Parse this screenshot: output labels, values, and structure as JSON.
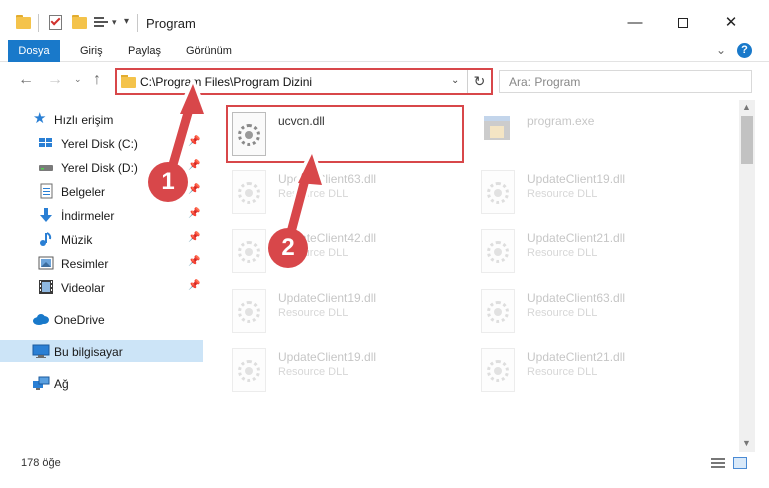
{
  "window": {
    "title": "Program",
    "minimize": "—",
    "maximize": "",
    "close": "✕"
  },
  "quick_access": {
    "dropdown_arrow": "▾",
    "customize_arrow": "▾"
  },
  "ribbon": {
    "tabs": [
      {
        "label": "Dosya"
      },
      {
        "label": "Giriş"
      },
      {
        "label": "Paylaş"
      },
      {
        "label": "Görünüm"
      }
    ],
    "collapse": "⌄",
    "help": "?"
  },
  "navigation": {
    "back": "←",
    "forward": "→",
    "recent": "⌄",
    "up": "↑"
  },
  "address": {
    "path": "C:\\Program Files\\Program Dizini",
    "dropdown": "⌄",
    "refresh": "↻"
  },
  "search": {
    "placeholder": "Ara: Program"
  },
  "sidebar": {
    "items": [
      {
        "label": "Hızlı erişim",
        "icon": "star-icon",
        "pinned": false
      },
      {
        "label": "Yerel Disk (C:)",
        "icon": "drive-icon",
        "pinned": true
      },
      {
        "label": "Yerel Disk (D:)",
        "icon": "drive-icon",
        "pinned": true
      },
      {
        "label": "Belgeler",
        "icon": "documents-icon",
        "pinned": true
      },
      {
        "label": "İndirmeler",
        "icon": "downloads-icon",
        "pinned": true
      },
      {
        "label": "Müzik",
        "icon": "music-icon",
        "pinned": true
      },
      {
        "label": "Resimler",
        "icon": "pictures-icon",
        "pinned": true
      },
      {
        "label": "Videolar",
        "icon": "videos-icon",
        "pinned": true
      },
      {
        "label": "OneDrive",
        "icon": "cloud-icon",
        "pinned": false
      },
      {
        "label": "Bu bilgisayar",
        "icon": "computer-icon",
        "pinned": false,
        "selected": true
      },
      {
        "label": "Ağ",
        "icon": "network-icon",
        "pinned": false
      }
    ],
    "pin_glyph": "📌"
  },
  "files": [
    {
      "name": "ucvcn.dll",
      "type": "",
      "icon": "dll-gear-icon",
      "selected": true
    },
    {
      "name": "program.exe",
      "type": "",
      "icon": "exe-icon"
    },
    {
      "name": "UpdateClient63.dll",
      "type": "Resource DLL",
      "icon": "dll-gear-icon"
    },
    {
      "name": "UpdateClient19.dll",
      "type": "Resource DLL",
      "icon": "dll-gear-icon"
    },
    {
      "name": "UpdateClient42.dll",
      "type": "Resource DLL",
      "icon": "dll-gear-icon"
    },
    {
      "name": "UpdateClient21.dll",
      "type": "Resource DLL",
      "icon": "dll-gear-icon"
    },
    {
      "name": "UpdateClient19.dll",
      "type": "Resource DLL",
      "icon": "dll-gear-icon"
    },
    {
      "name": "UpdateClient63.dll",
      "type": "Resource DLL",
      "icon": "dll-gear-icon"
    },
    {
      "name": "UpdateClient19.dll",
      "type": "Resource DLL",
      "icon": "dll-gear-icon"
    },
    {
      "name": "UpdateClient21.dll",
      "type": "Resource DLL",
      "icon": "dll-gear-icon"
    }
  ],
  "annotations": {
    "step1": "1",
    "step2": "2",
    "color": "#d8474a"
  },
  "status": {
    "item_count": "178 öğe"
  },
  "scrollbar": {
    "up": "▲",
    "down": "▼"
  },
  "colors": {
    "accent": "#1979ca",
    "selection": "#cce4f7",
    "highlight": "#d8474a",
    "folder": "#f4c34b"
  }
}
